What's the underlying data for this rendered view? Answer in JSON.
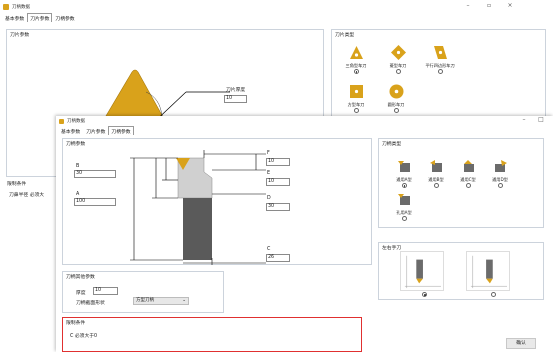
{
  "back_window": {
    "title": "刀柄数据",
    "tabs": [
      "基本参数",
      "刀片参数",
      "刀柄参数"
    ],
    "active_tab": 1,
    "blade_params_label": "刀片参数",
    "blade_type_label": "刀片类型",
    "blade_height": {
      "label": "刀片厚度",
      "value": "10"
    },
    "blade_types": [
      {
        "label": "三角型车刀",
        "selected": true
      },
      {
        "label": "菱型车刀",
        "selected": false
      },
      {
        "label": "平行四边形车刀",
        "selected": false
      },
      {
        "label": "方型车刀",
        "selected": false
      },
      {
        "label": "圆形车刀",
        "selected": false
      }
    ],
    "constraints_label": "限制条件",
    "constraint_text": "刀鼻半径 必须大"
  },
  "front_window": {
    "title": "刀柄数据",
    "tabs": [
      "基本参数",
      "刀片参数",
      "刀柄参数"
    ],
    "active_tab": 2,
    "holder_params_label": "刀柄参数",
    "holder_type_label": "刀柄类型",
    "dims": {
      "F": "10",
      "E": "10",
      "D": "30",
      "C": "26",
      "B": "30",
      "A": "100"
    },
    "holder_types": [
      {
        "label": "通用A型",
        "selected": true
      },
      {
        "label": "通用B型",
        "selected": false
      },
      {
        "label": "通用C型",
        "selected": false
      },
      {
        "label": "通用D型",
        "selected": false
      },
      {
        "label": "孔用A型",
        "selected": false
      }
    ],
    "hand_label": "左右手刀",
    "hand_selected": 0,
    "other_params_label": "刀柄其他参数",
    "thickness": {
      "label": "厚度",
      "value": "10"
    },
    "section_shape": {
      "label": "刀柄截面形状",
      "value": "方型刀柄"
    },
    "constraints_label": "限制条件",
    "constraint_text": "C 必须大于0",
    "confirm_label": "确认"
  },
  "colors": {
    "insert": "#d9a21b",
    "holder": "#5a5a5a",
    "alert_border": "#e03030"
  }
}
